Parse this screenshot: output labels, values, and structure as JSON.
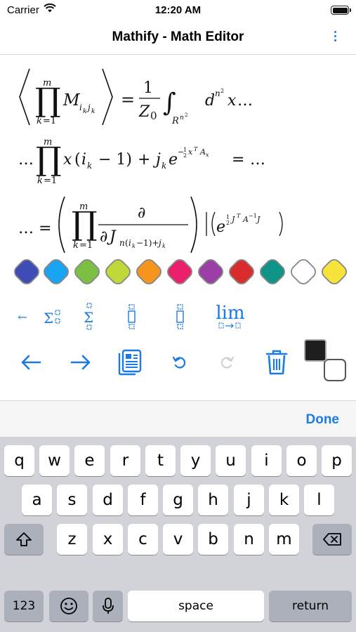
{
  "status_bar": {
    "carrier": "Carrier",
    "time": "12:20 AM",
    "wifi_icon": "wifi-icon",
    "battery_icon": "battery-icon"
  },
  "nav": {
    "title": "Mathify - Math Editor",
    "more_icon": "vertical-ellipsis-icon"
  },
  "math": {
    "line1": {
      "lhs": "⟨ ∏_{k=1}^{m} M_{i_k j_k} ⟩",
      "rhs": "= (1 / Z_0) ∫_{R^{n^2}} d^{n^2} x …"
    },
    "line2": "… ∏_{k=1}^{m} x (i_k − 1) + j_k e^{−½ x^T A_x} = …",
    "line3": "… = ( ∏_{k=1}^{m} ∂ / ∂J_{n(i_k−1)+j_k} ) |( e^{½ J^T A^{−1} J} )"
  },
  "colors": {
    "accent": "#1a7ae6",
    "swatches": [
      "#3d4db5",
      "#1aa3f0",
      "#7bc043",
      "#c2d83a",
      "#f7941d",
      "#ec1f6d",
      "#9b3fa6",
      "#d92c2c",
      "#0f9488",
      "#ffffff",
      "#f7e43a"
    ]
  },
  "templates": {
    "back_small": "←",
    "sum_with_limits": "Σ",
    "sum_stacked": "Σ",
    "bracket_left": "[]",
    "bracket_right": "[]",
    "limit": "lim"
  },
  "actions": {
    "back_icon": "arrow-left-icon",
    "forward_icon": "arrow-right-icon",
    "document_icon": "document-icon",
    "undo_icon": "undo-icon",
    "redo_icon": "redo-icon",
    "trash_icon": "trash-icon",
    "colors_icon": "foreground-background-icon"
  },
  "accessory": {
    "done_label": "Done"
  },
  "keyboard": {
    "row1": [
      "q",
      "w",
      "e",
      "r",
      "t",
      "y",
      "u",
      "i",
      "o",
      "p"
    ],
    "row2": [
      "a",
      "s",
      "d",
      "f",
      "g",
      "h",
      "j",
      "k",
      "l"
    ],
    "row3": [
      "z",
      "x",
      "c",
      "v",
      "b",
      "n",
      "m"
    ],
    "shift_icon": "shift-icon",
    "delete_icon": "delete-icon",
    "numbers_label": "123",
    "emoji_icon": "emoji-icon",
    "mic_icon": "microphone-icon",
    "space_label": "space",
    "return_label": "return"
  }
}
